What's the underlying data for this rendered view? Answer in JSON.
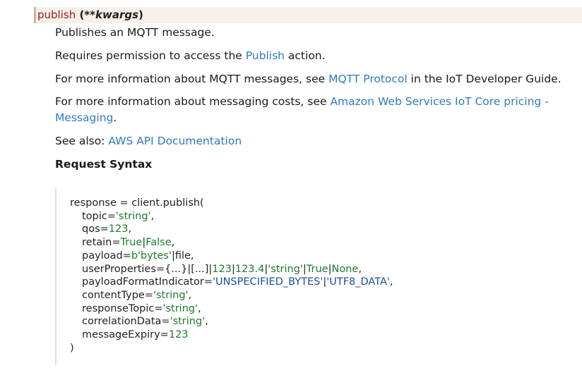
{
  "signature": {
    "name": "publish",
    "open": " (",
    "kwargs": "**kwargs",
    "close": ")"
  },
  "description": {
    "line1": "Publishes an MQTT message.",
    "line2_pre": "Requires permission to access the ",
    "line2_link": "Publish",
    "line2_post": " action.",
    "line3_pre": "For more information about MQTT messages, see ",
    "line3_link": "MQTT Protocol",
    "line3_post": " in the IoT Developer Guide.",
    "line4_pre": "For more information about messaging costs, see ",
    "line4_link_a": "Amazon Web Services IoT Core pricing -",
    "line4_link_b": "Messaging",
    "line4_post": ".",
    "see_also_pre": "See also: ",
    "see_also_link": "AWS API Documentation"
  },
  "request_syntax_heading": "Request Syntax",
  "code": {
    "l1": "response = client.publish(",
    "topic_key": "topic=",
    "topic_val": "'string'",
    "topic_end": ",",
    "qos_key": "qos=",
    "qos_val": "123",
    "qos_end": ",",
    "retain_key": "retain=",
    "retain_true": "True",
    "retain_sep": "|",
    "retain_false": "False",
    "retain_end": ",",
    "payload_key": "payload=",
    "payload_val": "b'bytes'",
    "payload_sep": "|",
    "payload_file": "file",
    "payload_end": ",",
    "up_key": "userProperties=",
    "up_dict": "{...}",
    "up_sep1": "|",
    "up_list": "[...]",
    "up_sep2": "|",
    "up_int": "123",
    "up_sep3": "|",
    "up_float": "123.4",
    "up_sep4": "|",
    "up_str": "'string'",
    "up_sep5": "|",
    "up_true": "True",
    "up_sep6": "|",
    "up_none": "None",
    "up_end": ",",
    "pfi_key": "payloadFormatIndicator=",
    "pfi_v1": "'UNSPECIFIED_BYTES'",
    "pfi_sep": "|",
    "pfi_v2": "'UTF8_DATA'",
    "pfi_end": ",",
    "ct_key": "contentType=",
    "ct_val": "'string'",
    "ct_end": ",",
    "rt_key": "responseTopic=",
    "rt_val": "'string'",
    "rt_end": ",",
    "cd_key": "correlationData=",
    "cd_val": "'string'",
    "cd_end": ",",
    "me_key": "messageExpiry=",
    "me_val": "123",
    "close": ")"
  },
  "colors": {
    "link": "#2f7bbf",
    "function_name": "#9b1b1b",
    "string_literal": "#1d7a2e",
    "enum_literal": "#1a4fa0",
    "signature_bg": "#f5f1ea"
  }
}
